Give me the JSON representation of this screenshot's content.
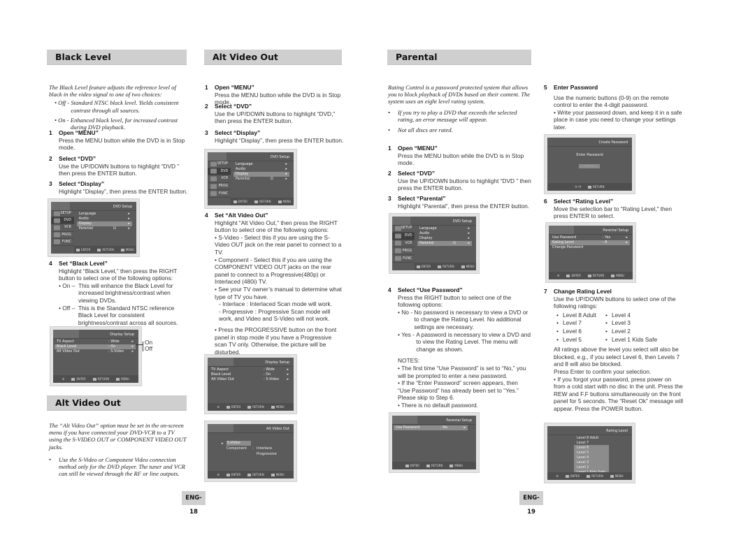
{
  "black_level": {
    "header": "Black Level",
    "intro": "The Black Level feature adjusts the reference level of black in the video signal to one of two choices:",
    "choices": [
      {
        "key": "• Off - ",
        "text": "Standard NTSC black level. Yields consistent contrast through all sources."
      },
      {
        "key": "• On - ",
        "text": "Enhanced black level, for increased contrast during DVD playback."
      }
    ],
    "steps": [
      {
        "num": "1",
        "title": "Open “MENU”",
        "body": "Press the MENU button while the DVD is in Stop mode."
      },
      {
        "num": "2",
        "title": "Select “DVD”",
        "body": "Use the UP/DOWN buttons to highlight “DVD ” then press the ENTER button."
      },
      {
        "num": "3",
        "title": "Select “Display”",
        "body": "Highlight “Display”, then press the ENTER button."
      },
      {
        "num": "4",
        "title": "Set “Black Level”",
        "body": "Highlight “Black Level,” then press the RIGHT button to select one of the following options:",
        "options": [
          {
            "key": "• On –  ",
            "text": "This will enhance the Black Level for increased brightness/contrast when viewing DVDs."
          },
          {
            "key": "• Off –  ",
            "text": "This is the Standard NTSC reference Black Level for consistent brightness/contrast across all sources."
          }
        ]
      }
    ],
    "callout": {
      "on": "On",
      "off": "Off"
    }
  },
  "alt_video_left": {
    "header": "Alt Video Out",
    "intro": "The “Alt  Video Out” option must be set in the on-screen menu if you have connected your DVD-VCR to a TV using the S-VIDEO OUT or COMPONENT VIDEO OUT jacks.",
    "bullet": "Use the S-Video or Component Video connection method only for the DVD player. The tuner and VCR can still be viewed through the RF or line outputs."
  },
  "alt_video": {
    "header": "Alt Video Out",
    "steps": [
      {
        "num": "1",
        "title": "Open “MENU”",
        "body": "Press the MENU button while the DVD is in Stop mode."
      },
      {
        "num": "2",
        "title": "Select “DVD”",
        "body": "Use the UP/DOWN buttons to highlight “DVD,” then press the ENTER button."
      },
      {
        "num": "3",
        "title": "Select “Display”",
        "body": "Highlight “Display”, then press the ENTER button."
      },
      {
        "num": "4",
        "title": "Set “Alt Video Out”",
        "body": "Highlight “Alt Video Out,” then press the RIGHT button to select one of the following options:",
        "bullets": [
          "• S-Video - Select this if you are using the S-Video OUT jack on the rear panel to connect to a TV.",
          "• Component - Select this if you are using the COMPONENT VIDEO OUT jacks on the rear panel to connect to a Progressive(480p) or Interlaced (480i) TV.",
          "• See your TV owner’s manual to determine what type of TV you have.",
          "- Interlace : Interlaced Scan mode will work.",
          "- Progressive : Progressive Scan mode will work, and Video and S-Video will not work.",
          "• Press the PROGRESSIVE button on the front panel in stop mode if you have a Progressive scan TV only. Otherwise, the picture will be disturbed."
        ]
      }
    ]
  },
  "parental": {
    "header": "Parental",
    "intro": "Rating Control is a password protected system that allows you to block playback of DVDs based on their content. The system uses an eight level rating system.",
    "bullets": [
      "If you try to play a DVD that exceeds the selected rating, an error message will appear.",
      "Not all discs are rated."
    ],
    "steps": [
      {
        "num": "1",
        "title": "Open “MENU”",
        "body": "Press the MENU button while the DVD is in Stop mode."
      },
      {
        "num": "2",
        "title": "Select “DVD”",
        "body": "Use the UP/DOWN buttons to highlight “DVD ” then press the ENTER button."
      },
      {
        "num": "3",
        "title": "Select “Parental”",
        "body": "Highlight “Parental”, then press the ENTER button."
      },
      {
        "num": "4",
        "title": "Select “Use Password”",
        "body": "Press the RIGHT button to select one of the following options:",
        "options": [
          {
            "key": "• No - ",
            "text": "No password is necessary to view a DVD or to change the  Rating Level. No additional settings are necessary."
          },
          {
            "key": "• Yes - ",
            "text": "A password is necessary to view a DVD and to view the Rating Level. The menu will change as shown."
          }
        ],
        "notes_title": "NOTES:",
        "notes": [
          "• The first time “Use Password” is set to “No,” you will be prompted to enter a new password.",
          "• If the “Enter Password” screen appears, then “Use Password” has already been set to “Yes.” Please skip to Step 6.",
          "• There is no default password."
        ]
      },
      {
        "num": "5",
        "title": "Enter Password",
        "body": "Use the numeric buttons (0-9) on the remote control to enter the 4-digit password.",
        "bullets": [
          "• Write your password down, and keep it in a safe place in case you need to change your settings later."
        ]
      },
      {
        "num": "6",
        "title": "Select “Rating Level”",
        "body": "Move the selection bar to “Rating Level,” then press ENTER to select."
      },
      {
        "num": "7",
        "title": "Change Rating Level",
        "body": "Use the UP/DOWN buttons to select one of the following ratings:",
        "ratings": [
          "Level 8 Adult",
          "Level 4",
          "Level 7",
          "Level 3",
          "Level 6",
          "Level 2",
          "Level 5",
          "Level 1 Kids Safe"
        ],
        "after": "All ratings above the level you select will also be blocked, e.g., if you select Level 6, then Levels 7 and 8 will also be blocked.",
        "confirm": "Press Enter to confirm your selection.",
        "bullets": [
          "• If you forgot your password, press power on from a cold start with no disc in the unit. Press the REW and F.F buttons simultaneously on the front panel for 5 seconds. The “Reset Ok” message will appear. Press the POWER button."
        ]
      }
    ]
  },
  "screens": {
    "footer": {
      "enter": "ENTER",
      "return": "RETURN",
      "menu": "MENU",
      "digits": "0~9"
    },
    "dvd_setup": {
      "title": "DVD Setup",
      "side": [
        "SETUP",
        "DVD",
        "VCR",
        "PROG",
        "FUNC"
      ],
      "items": [
        "Language",
        "Audio",
        "Display",
        "Parental"
      ]
    },
    "display_setup": {
      "title": "Display Setup",
      "rows": [
        {
          "label": "TV Aspect",
          "value": ": Wide"
        },
        {
          "label": "Black Level",
          "value": ": On"
        },
        {
          "label": "Alt Video Out",
          "value": ": S-Video"
        }
      ]
    },
    "alt_video_out": {
      "title": "Alt Video Out",
      "svideo": "S-Video",
      "component": "Component",
      "colon": ":",
      "interlace": "Interlace",
      "progressive": "Progressive"
    },
    "parental_setup_no": {
      "title": "Parental Setup",
      "label": "Use Password",
      "value": ": No"
    },
    "create_password": {
      "title": "Create Password",
      "prompt": "Enter Password",
      "mask": "- - - -"
    },
    "parental_setup_yes": {
      "title": "Parental Setup",
      "rows": [
        {
          "label": "Use Password",
          "value": ": Yes"
        },
        {
          "label": "Rating Level",
          "value": ": 8"
        },
        {
          "label": "Change Password",
          "value": ""
        }
      ]
    },
    "rating_level": {
      "title": "Rating Level",
      "levels": [
        "Level  8  Adult",
        "Level  7",
        "Level  6",
        "Level  5",
        "Level  4",
        "Level  3",
        "Level  2",
        "Level  1 Kids Safe"
      ]
    }
  },
  "page_numbers": {
    "left": "ENG-18",
    "right": "ENG-19"
  }
}
